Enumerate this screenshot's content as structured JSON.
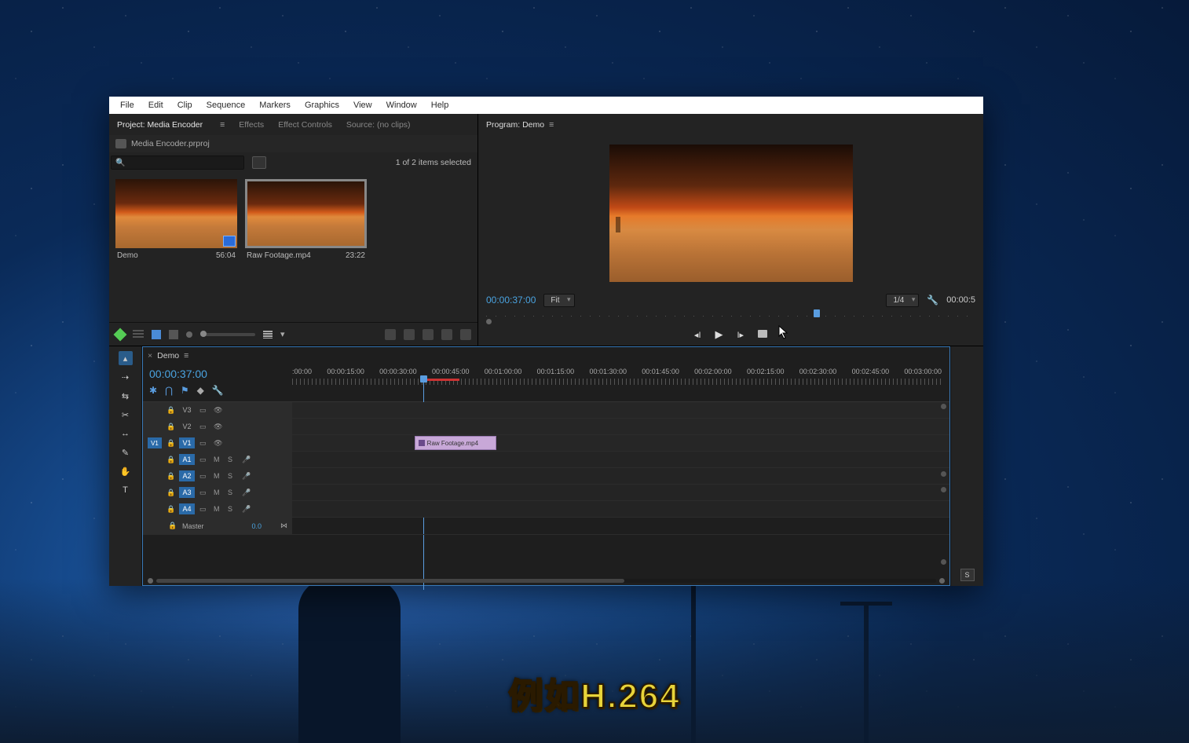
{
  "menu": [
    "File",
    "Edit",
    "Clip",
    "Sequence",
    "Markers",
    "Graphics",
    "View",
    "Window",
    "Help"
  ],
  "project": {
    "tabs": [
      "Project: Media Encoder",
      "Effects",
      "Effect Controls",
      "Source: (no clips)"
    ],
    "file": "Media Encoder.prproj",
    "search_placeholder": "",
    "selection_status": "1 of 2 items selected",
    "bins": [
      {
        "name": "Demo",
        "duration": "56:04",
        "selected": false,
        "is_sequence": true
      },
      {
        "name": "Raw Footage.mp4",
        "duration": "23:22",
        "selected": true,
        "is_sequence": false
      }
    ]
  },
  "program": {
    "tab": "Program: Demo",
    "timecode": "00:00:37:00",
    "fit": "Fit",
    "quality": "1/4",
    "out_tc": "00:00:5"
  },
  "timeline": {
    "tab": "Demo",
    "timecode": "00:00:37:00",
    "ruler": [
      ":00:00",
      "00:00:15:00",
      "00:00:30:00",
      "00:00:45:00",
      "00:01:00:00",
      "00:01:15:00",
      "00:01:30:00",
      "00:01:45:00",
      "00:02:00:00",
      "00:02:15:00",
      "00:02:30:00",
      "00:02:45:00",
      "00:03:00:00"
    ],
    "video_tracks": [
      {
        "name": "V3",
        "src": "",
        "src_on": false
      },
      {
        "name": "V2",
        "src": "",
        "src_on": false
      },
      {
        "name": "V1",
        "src": "V1",
        "src_on": true
      }
    ],
    "audio_tracks": [
      {
        "name": "A1",
        "src": "A1",
        "src_on": true
      },
      {
        "name": "A2",
        "src": "A2",
        "src_on": true
      },
      {
        "name": "A3",
        "src": "A3",
        "src_on": true
      },
      {
        "name": "A4",
        "src": "A4",
        "src_on": true
      }
    ],
    "master": {
      "label": "Master",
      "value": "0.0"
    },
    "clip_name": "Raw Footage.mp4"
  },
  "sidecol_label": "S",
  "mute_label": "M",
  "solo_label": "S",
  "subtitle": "例如H.264"
}
